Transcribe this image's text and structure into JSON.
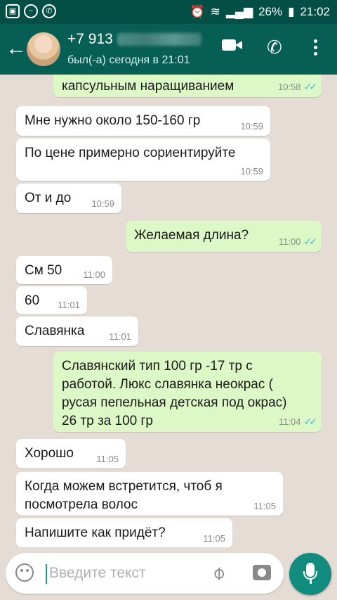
{
  "statusbar": {
    "battery": "26%",
    "time": "21:02"
  },
  "header": {
    "contact_name": "+7 913",
    "contact_status": "был(-а) сегодня в 21:01"
  },
  "messages": [
    {
      "text": "капсульным наращиванием",
      "time": "10:58",
      "direction": "out",
      "read": true
    },
    {
      "text": "Мне нужно около 150-160 гр",
      "time": "10:59",
      "direction": "in"
    },
    {
      "text": "По цене примерно сориентируйте",
      "time": "10:59",
      "direction": "in"
    },
    {
      "text": "От и до",
      "time": "10:59",
      "direction": "in"
    },
    {
      "text": "Желаемая длина?",
      "time": "11:00",
      "direction": "out",
      "read": true
    },
    {
      "text": "См 50",
      "time": "11:00",
      "direction": "in"
    },
    {
      "text": "60",
      "time": "11:01",
      "direction": "in"
    },
    {
      "text": "Славянка",
      "time": "11:01",
      "direction": "in"
    },
    {
      "text": "Славянский тип 100 гр -17 тр с работой. Люкс славянка неокрас ( русая пепельная детская  под окрас) 26 тр за 100 гр",
      "time": "11:04",
      "direction": "out",
      "read": true
    },
    {
      "text": "Хорошо",
      "time": "11:05",
      "direction": "in"
    },
    {
      "text": "Когда можем встретится, чтоб я посмотрела волос",
      "time": "11:05",
      "direction": "in"
    },
    {
      "text": "Напишите как придёт?",
      "time": "11:05",
      "direction": "in"
    }
  ],
  "input": {
    "placeholder": "Введите текст"
  },
  "colors": {
    "header": "#075e54",
    "statusbar": "#044f45",
    "outgoing": "#dcf8c6",
    "incoming": "#ffffff",
    "accent": "#128c7e",
    "read_ticks": "#4fb4e8"
  },
  "icons": [
    "back-arrow-icon",
    "video-call-icon",
    "phone-icon",
    "more-menu-icon",
    "emoji-icon",
    "attach-icon",
    "camera-icon",
    "mic-icon"
  ]
}
